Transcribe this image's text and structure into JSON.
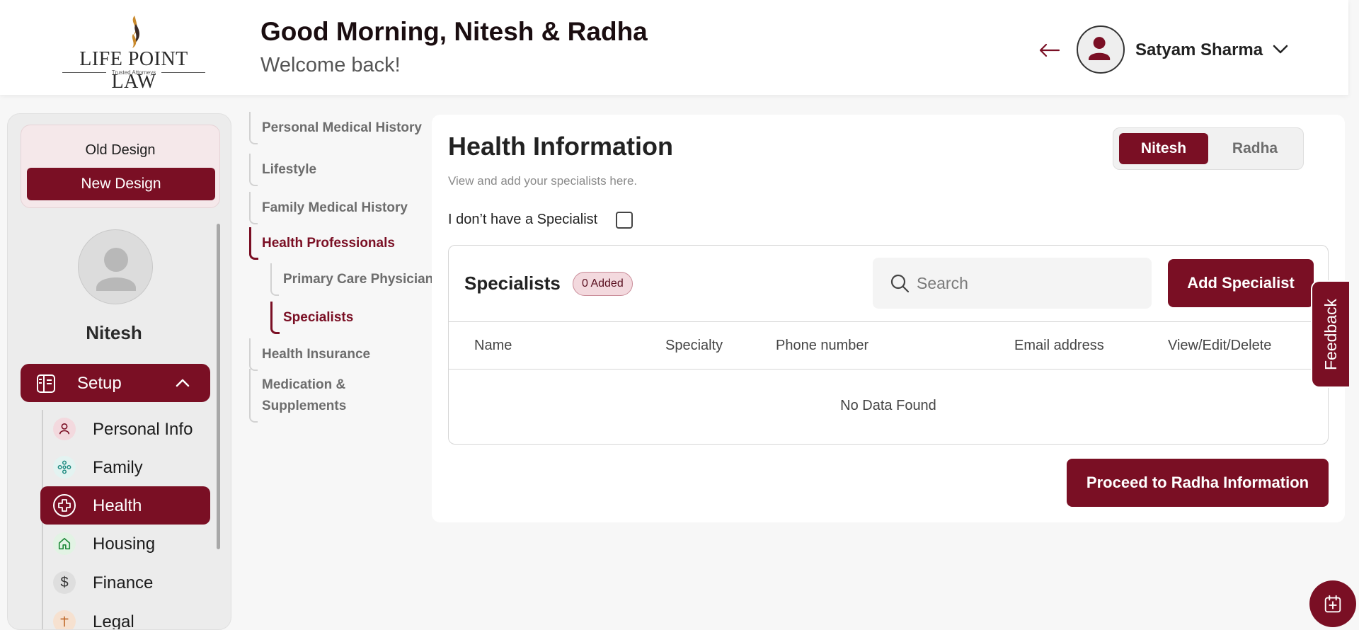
{
  "header": {
    "logo": {
      "text": "LIFE POINT LAW",
      "tagline": "Trusted Attorneys"
    },
    "greeting": "Good Morning, Nitesh & Radha",
    "welcome": "Welcome back!",
    "user_name": "Satyam Sharma"
  },
  "sidebar": {
    "old_design": "Old Design",
    "new_design": "New Design",
    "profile_name": "Nitesh",
    "setup_label": "Setup",
    "items": [
      {
        "label": "Personal Info",
        "icon": "person-icon"
      },
      {
        "label": "Family",
        "icon": "family-icon"
      },
      {
        "label": "Health",
        "icon": "health-cross-icon",
        "active": true
      },
      {
        "label": "Housing",
        "icon": "house-icon"
      },
      {
        "label": "Finance",
        "icon": "dollar-icon"
      },
      {
        "label": "Legal",
        "icon": "legal-icon"
      }
    ]
  },
  "subnav": {
    "items": [
      "Personal Medical History",
      "Lifestyle",
      "Family Medical History",
      "Health Professionals",
      "Primary Care Physician",
      "Specialists",
      "Health Insurance",
      "Medication &",
      "Supplements"
    ],
    "active": [
      "Health Professionals",
      "Specialists"
    ]
  },
  "main": {
    "title": "Health Information",
    "subtitle": "View and add your specialists here.",
    "toggle": {
      "selected": "Nitesh",
      "other": "Radha"
    },
    "no_specialist_label": "I don’t have a Specialist",
    "specialists": {
      "title": "Specialists",
      "badge": "0 Added",
      "search_placeholder": "Search",
      "add_button": "Add Specialist",
      "columns": [
        "Name",
        "Specialty",
        "Phone number",
        "Email address",
        "View/Edit/Delete"
      ],
      "rows": [],
      "empty_text": "No Data Found"
    },
    "proceed_button": "Proceed to Radha Information"
  },
  "feedback_label": "Feedback",
  "colors": {
    "brand": "#7a0f24",
    "background": "#f7f7f7"
  }
}
